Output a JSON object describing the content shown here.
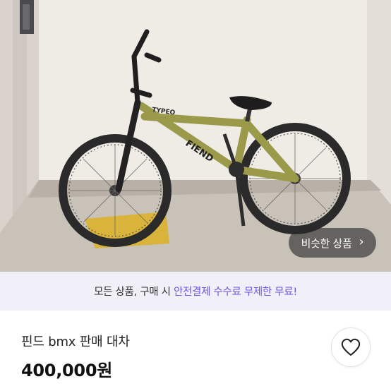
{
  "photo": {
    "alt_icon": "bmx-bicycle-photo",
    "frame_text_top": "TYPEO",
    "frame_text_main": "FIEND"
  },
  "similar_button": {
    "label": "비슷한 상품",
    "chevron": "›"
  },
  "banner": {
    "prefix": "모든 상품, 구매 시 ",
    "highlight": "안전결제 수수료 무제한 무료!",
    "highlight_color": "#6a55e6"
  },
  "listing": {
    "title": "핀드 bmx 판매 대차",
    "price": "400,000원"
  },
  "like_button": {
    "icon": "heart-outline-icon"
  }
}
